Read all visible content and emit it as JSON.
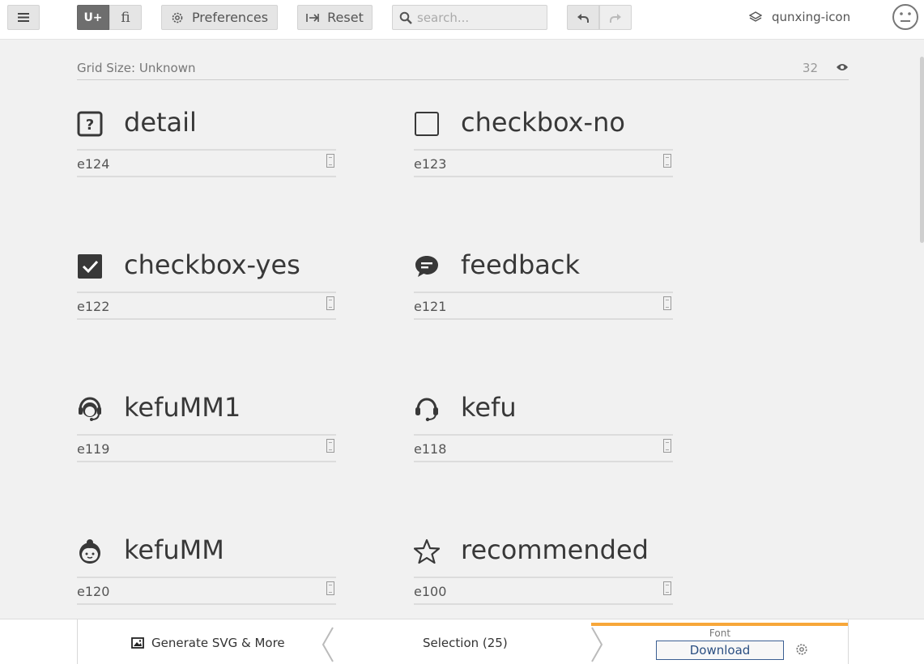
{
  "toolbar": {
    "menu_icon": "hamburger-icon",
    "uplus_label": "U+",
    "fi_label": "fi",
    "preferences_label": "Preferences",
    "reset_label": "Reset",
    "search_placeholder": "search...",
    "search_value": "",
    "project_name": "qunxing-icon"
  },
  "grid": {
    "label": "Grid Size: Unknown",
    "size": "32"
  },
  "glyphs": [
    {
      "name": "detail",
      "code": "e124",
      "icon": "question-square-icon"
    },
    {
      "name": "checkbox-no",
      "code": "e123",
      "icon": "checkbox-empty-icon"
    },
    {
      "name": "checkbox-yes",
      "code": "e122",
      "icon": "checkbox-checked-icon"
    },
    {
      "name": "feedback",
      "code": "e121",
      "icon": "chat-bubble-icon"
    },
    {
      "name": "kefuMM1",
      "code": "e119",
      "icon": "headset-agent-icon"
    },
    {
      "name": "kefu",
      "code": "e118",
      "icon": "headset-icon"
    },
    {
      "name": "kefuMM",
      "code": "e120",
      "icon": "woman-face-icon"
    },
    {
      "name": "recommended",
      "code": "e100",
      "icon": "star-outline-icon"
    }
  ],
  "bottom": {
    "generate_label": "Generate SVG & More",
    "selection_label": "Selection (25)",
    "font_label": "Font",
    "download_label": "Download"
  },
  "colors": {
    "accent": "#f7a73a",
    "download_border": "#3b5f93",
    "active_toggle": "#6e6e6e"
  }
}
